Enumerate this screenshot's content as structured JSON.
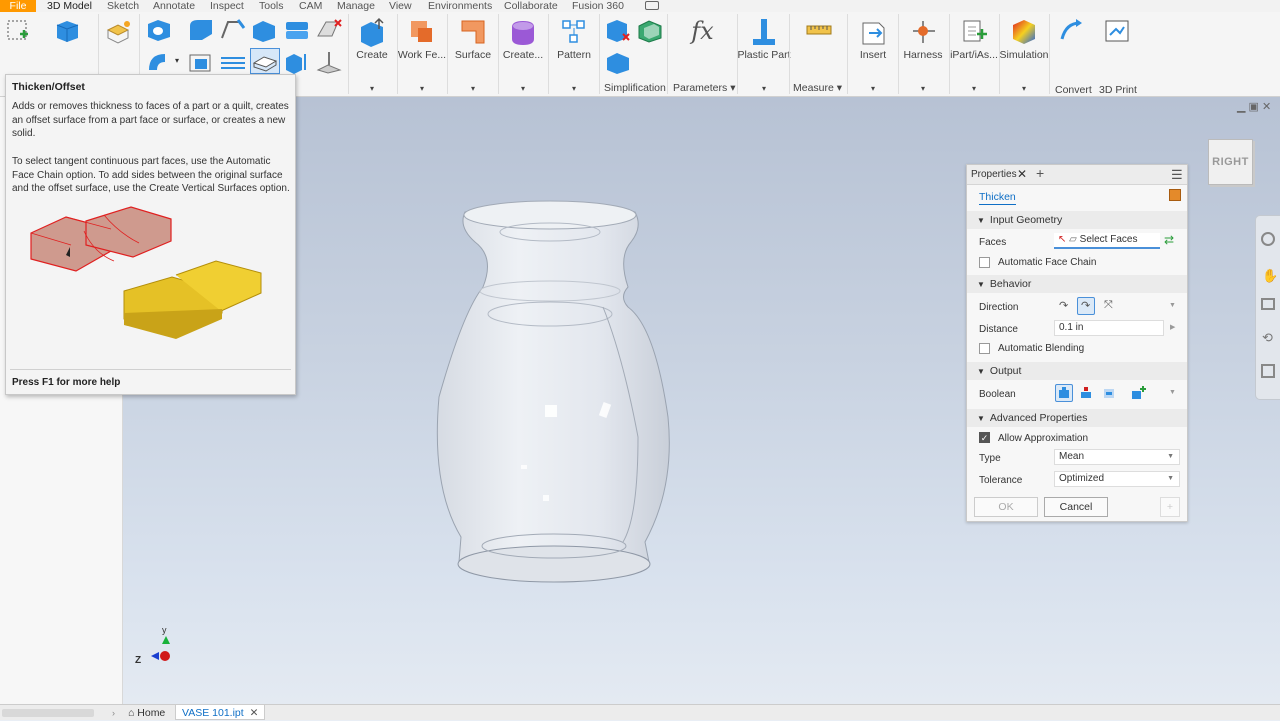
{
  "menubar": {
    "items": [
      "File",
      "3D Model",
      "Sketch",
      "Annotate",
      "Inspect",
      "Tools",
      "CAM",
      "Manage",
      "View",
      "Environments",
      "Collaborate",
      "Fusion 360"
    ]
  },
  "ribbon": {
    "buttons": [
      {
        "label": "Create",
        "icon": "extrude-cube-icon"
      },
      {
        "label": "Work Fe...",
        "icon": "work-plane-icon"
      },
      {
        "label": "Surface",
        "icon": "surface-icon"
      },
      {
        "label": "Create...",
        "icon": "freeform-icon"
      },
      {
        "label": "Pattern",
        "icon": "pattern-icon"
      },
      {
        "label": "Plastic Part",
        "icon": "plastic-part-icon"
      },
      {
        "label": "Insert",
        "icon": "insert-icon"
      },
      {
        "label": "Harness",
        "icon": "harness-icon"
      },
      {
        "label": "iPart/iAs...",
        "icon": "ipart-icon"
      },
      {
        "label": "Simulation",
        "icon": "simulation-icon"
      },
      {
        "label": "Convert",
        "icon": "convert-icon"
      },
      {
        "label": "3D Print",
        "icon": "print-3d-icon"
      }
    ],
    "fx_label": "fx",
    "groups": {
      "simplification": "Simplification",
      "parameters": "Parameters",
      "measure": "Measure"
    }
  },
  "tooltip": {
    "title": "Thicken/Offset",
    "para1": "Adds or removes thickness to faces of a part or a quilt, creates an offset surface from a part face or surface, or creates a new solid.",
    "para2": "To select tangent continuous part faces, use the Automatic Face Chain option. To add sides between the original surface and the offset surface, use the Create Vertical Surfaces option.",
    "footer": "Press F1 for more help"
  },
  "properties": {
    "tab": "Properties",
    "feature": "Thicken",
    "sections": {
      "input": "Input Geometry",
      "behavior": "Behavior",
      "output": "Output",
      "advanced": "Advanced Properties"
    },
    "faces_label": "Faces",
    "faces_value": "Select Faces",
    "auto_face_chain": "Automatic Face Chain",
    "auto_face_chain_checked": false,
    "direction_label": "Direction",
    "distance_label": "Distance",
    "distance_value": "0.1 in",
    "auto_blending": "Automatic Blending",
    "auto_blending_checked": false,
    "boolean_label": "Boolean",
    "allow_approx": "Allow Approximation",
    "allow_approx_checked": true,
    "type_label": "Type",
    "type_value": "Mean",
    "tolerance_label": "Tolerance",
    "tolerance_value": "Optimized",
    "ok": "OK",
    "cancel": "Cancel"
  },
  "viewcube": {
    "face": "RIGHT"
  },
  "statusbar": {
    "home": "Home",
    "doc_tab": "VASE 101.ipt"
  },
  "colors": {
    "accent": "#0f6fc6",
    "file_tab": "#ff9900",
    "model": "#e8eaee"
  }
}
